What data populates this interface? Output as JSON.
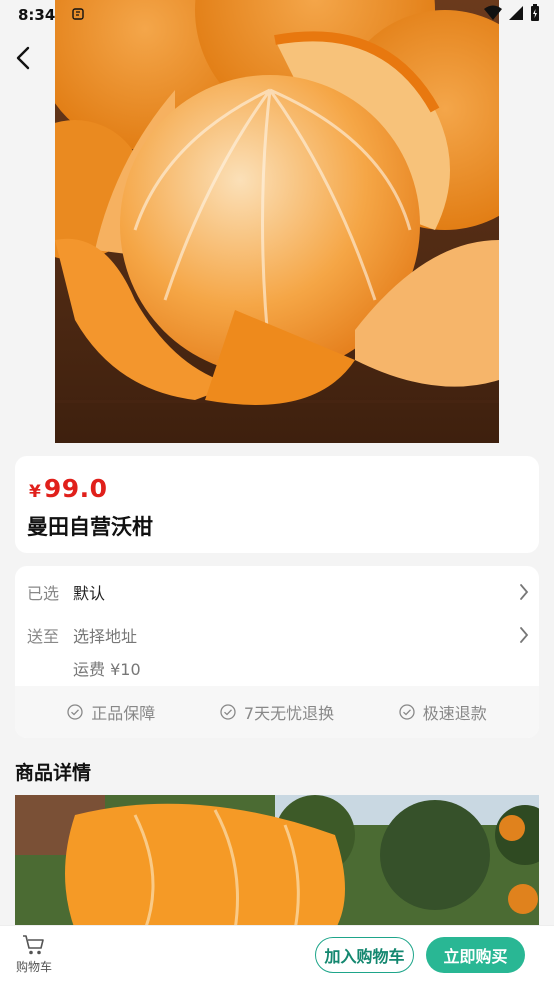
{
  "status_bar": {
    "time": "8:34"
  },
  "product": {
    "currency": "¥",
    "price": "99.0",
    "title": "曼田自营沃柑"
  },
  "options": {
    "selected_label": "已选",
    "selected_value": "默认",
    "delivery_label": "送至",
    "delivery_value": "选择地址",
    "shipping_text": "运费  ¥10"
  },
  "guarantees": [
    {
      "label": "正品保障",
      "icon": "check-circle-icon"
    },
    {
      "label": "7天无忧退换",
      "icon": "check-circle-icon"
    },
    {
      "label": "极速退款",
      "icon": "check-circle-icon"
    }
  ],
  "details": {
    "title": "商品详情"
  },
  "bottom_bar": {
    "cart_label": "购物车",
    "add_to_cart": "加入购物车",
    "buy_now": "立即购买"
  },
  "colors": {
    "price": "#e0201b",
    "accent_green": "#29b794",
    "accent_green_dark": "#13876f",
    "background": "#f4f4f4"
  }
}
